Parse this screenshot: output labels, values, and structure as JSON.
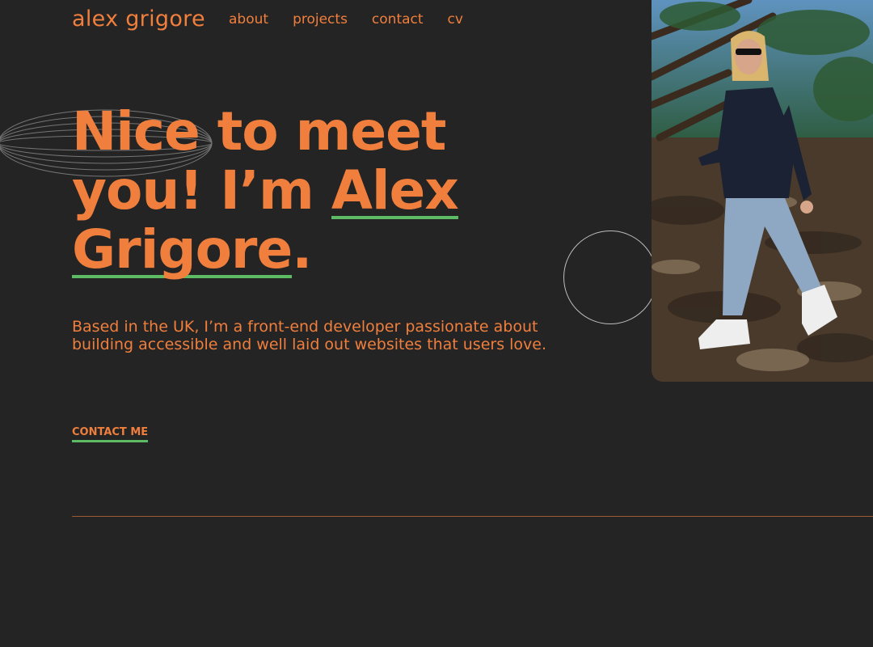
{
  "header": {
    "logo": "alex grigore",
    "nav": [
      "about",
      "projects",
      "contact",
      "cv"
    ]
  },
  "hero": {
    "headline_part1": "Nice to meet you! I’m ",
    "headline_name1": "Alex",
    "headline_name2": "Grigore",
    "headline_end": ".",
    "intro": "Based in the UK, I’m a front-end developer passionate about building accessible and well laid out websites that users love.",
    "cta_label": "CONTACT ME"
  },
  "colors": {
    "background": "#242424",
    "accent": "#f07f3d",
    "underline": "#5dbb63"
  }
}
